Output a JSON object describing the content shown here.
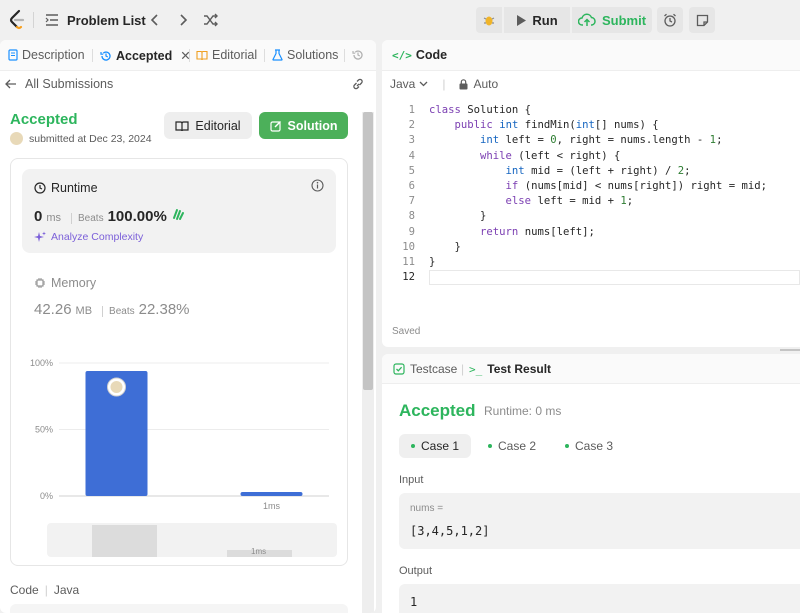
{
  "topbar": {
    "problem_list_label": "Problem List",
    "run_label": "Run",
    "submit_label": "Submit"
  },
  "left": {
    "tabs": [
      {
        "label": "Description"
      },
      {
        "label": "Accepted"
      },
      {
        "label": "Editorial"
      },
      {
        "label": "Solutions"
      }
    ],
    "back_label": "All Submissions",
    "status": "Accepted",
    "submitted_text": "submitted at Dec 23, 2024",
    "editorial_button": "Editorial",
    "solution_button": "Solution",
    "runtime": {
      "title": "Runtime",
      "value": "0",
      "unit": "ms",
      "beats_label": "Beats",
      "beats_value": "100.00%",
      "analyze_label": "Analyze Complexity"
    },
    "memory": {
      "title": "Memory",
      "value": "42.26",
      "unit": "MB",
      "beats_label": "Beats",
      "beats_value": "22.38%"
    },
    "code_label": "Code",
    "code_lang": "Java"
  },
  "chart_data": {
    "type": "bar",
    "categories": [
      "",
      "1ms"
    ],
    "values": [
      94,
      3
    ],
    "yticks": [
      "100%",
      "50%",
      "0%"
    ],
    "ylim": [
      0,
      100
    ],
    "minimap_label": "1ms",
    "colors": {
      "bar": "#3e6ed6"
    }
  },
  "editor": {
    "tab_label": "Code",
    "language": "Java",
    "mode": "Auto",
    "saved_label": "Saved",
    "lines": [
      "class Solution {",
      "    public int findMin(int[] nums) {",
      "        int left = 0, right = nums.length - 1;",
      "        while (left < right) {",
      "            int mid = (left + right) / 2;",
      "            if (nums[mid] < nums[right]) right = mid;",
      "            else left = mid + 1;",
      "        }",
      "        return nums[left];",
      "    }",
      "}",
      ""
    ]
  },
  "tests": {
    "tab_testcase": "Testcase",
    "tab_result": "Test Result",
    "status": "Accepted",
    "runtime_text": "Runtime: 0 ms",
    "cases": [
      "Case 1",
      "Case 2",
      "Case 3"
    ],
    "input_label": "Input",
    "input_var": "nums =",
    "input_value": "[3,4,5,1,2]",
    "output_label": "Output",
    "output_value": "1"
  },
  "colors": {
    "accepted_green": "#2db55d",
    "solution_button": "#4cb05a",
    "accent_purple": "#7b5fd9"
  }
}
